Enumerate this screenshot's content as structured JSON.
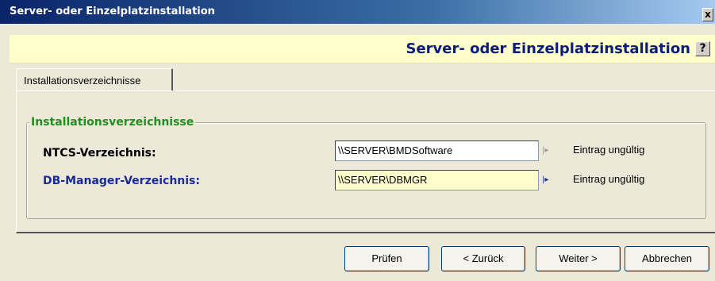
{
  "window": {
    "title": "Server- oder Einzelplatzinstallation",
    "close_glyph": "x"
  },
  "header": {
    "title": "Server- oder Einzelplatzinstallation",
    "help_glyph": "?"
  },
  "tabs": [
    {
      "label": "Installationsverzeichnisse"
    }
  ],
  "group": {
    "title": "Installationsverzeichnisse",
    "rows": [
      {
        "label": "NTCS-Verzeichnis:",
        "value": "\\\\SERVER\\BMDSoftware",
        "status": "Eintrag ungültig"
      },
      {
        "label": "DB-Manager-Verzeichnis:",
        "value": "\\\\SERVER\\DBMGR",
        "status": "Eintrag ungültig"
      }
    ]
  },
  "buttons": {
    "check": "Prüfen",
    "back": "< Zurück",
    "next": "Weiter >",
    "cancel": "Abbrechen"
  },
  "colors": {
    "titlebar": "#0a246a",
    "header_bg": "#ffffcc",
    "header_text": "#0c1c7c",
    "group_title": "#1f8f1f",
    "active_label": "#1a2a9c",
    "active_field_bg": "#ffffcc"
  },
  "icons": {
    "field_arrow": "triangle-right-icon"
  }
}
